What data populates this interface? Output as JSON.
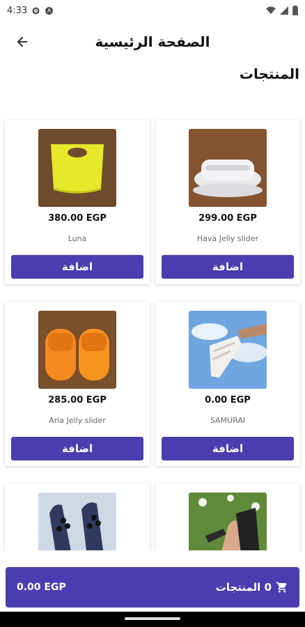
{
  "status_bar": {
    "time": "4:33",
    "icons": [
      "settings-gear-icon",
      "alert-icon",
      "wifi-icon",
      "signal-icon",
      "battery-icon"
    ]
  },
  "app_bar": {
    "title": "الصفحة الرئيسية",
    "back_icon": "arrow-left-icon"
  },
  "section": {
    "title": "المنتجات"
  },
  "theme": {
    "accent": "#4a3db0"
  },
  "products": [
    {
      "name": "Hava Jelly slider",
      "price": "299.00 EGP",
      "button": "اضافة",
      "image": "white-slide-sandal"
    },
    {
      "name": "Luna",
      "price": "380.00 EGP",
      "button": "اضافة",
      "image": "yellow-jelly-bag"
    },
    {
      "name": "SAMURAI",
      "price": "0.00 EGP",
      "button": "اضافة",
      "image": "white-sandal-sky"
    },
    {
      "name": "Aria Jelly slider",
      "price": "285.00 EGP",
      "button": "اضافة",
      "image": "orange-slides"
    },
    {
      "name": "",
      "price": "",
      "button": "",
      "image": "black-sandal-foot"
    },
    {
      "name": "",
      "price": "",
      "button": "",
      "image": "navy-beaded-sandals"
    }
  ],
  "cart": {
    "count_label": "0 المنتجات",
    "total": "0.00 EGP",
    "icon": "cart-icon"
  }
}
